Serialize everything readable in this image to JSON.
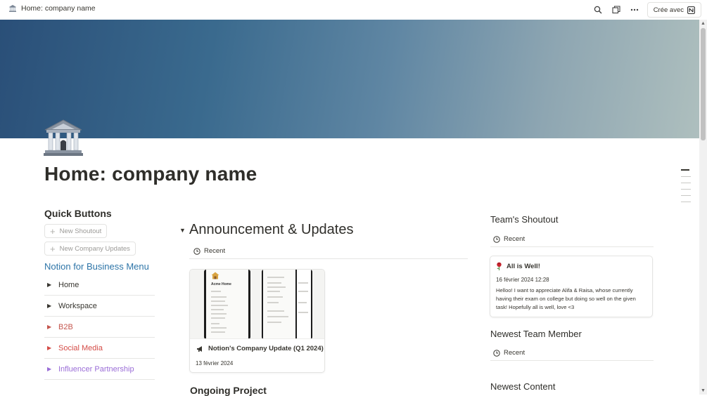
{
  "topbar": {
    "title": "Home: company name",
    "cree_label": "Crée avec"
  },
  "page": {
    "title": "Home: company name"
  },
  "quick_buttons": {
    "heading": "Quick Buttons",
    "buttons": [
      "New Shoutout",
      "New Company Updates"
    ]
  },
  "menu": {
    "heading": "Notion for Business Menu",
    "items": [
      {
        "label": "Home",
        "color": "#37352f"
      },
      {
        "label": "Workspace",
        "color": "#37352f"
      },
      {
        "label": "B2B",
        "color": "#c4554d"
      },
      {
        "label": "Social Media",
        "color": "#d44c47"
      },
      {
        "label": "Influencer Partnership",
        "color": "#9a6dd7"
      }
    ]
  },
  "announcements": {
    "heading": "Announcement & Updates",
    "view_label": "Recent",
    "card": {
      "title": "Notion's Company Update (Q1 2024)",
      "date": "13 février 2024",
      "preview_heading": "Acme Home"
    }
  },
  "ongoing": {
    "heading": "Ongoing Project"
  },
  "shoutout": {
    "heading": "Team's Shoutout",
    "view_label": "Recent",
    "card": {
      "title": "All is Well!",
      "date": "16 février 2024 12:28",
      "body": "Helloo! I want to appreciate Alifa & Raisa, whose currently having their exam on college but doing so well on the given task! Hopefully all is well, love <3"
    }
  },
  "newest_member": {
    "heading": "Newest Team Member",
    "view_label": "Recent"
  },
  "newest_content": {
    "heading": "Newest Content"
  },
  "colors": {
    "link_blue": "#2e75a8",
    "cover_start": "#2a4f78",
    "cover_end": "#aebfbe"
  },
  "icons": {
    "page_icon": "classical-building-icon",
    "search": "search-icon",
    "duplicate": "duplicate-icon",
    "more": "more-horizontal-icon",
    "notion": "notion-logo-icon",
    "clock": "clock-icon",
    "megaphone": "megaphone-icon",
    "rose": "rose-icon"
  }
}
